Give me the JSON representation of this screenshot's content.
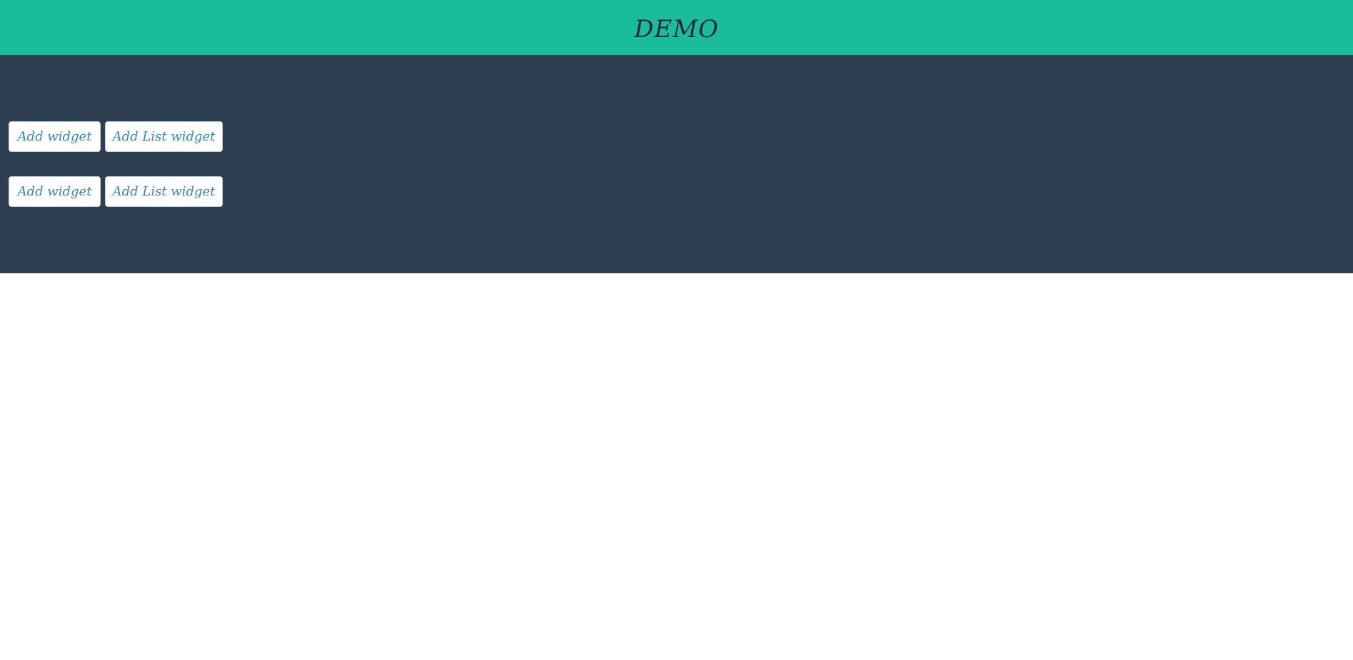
{
  "header": {
    "title": "DEMO"
  },
  "main": {
    "rows": [
      {
        "add_widget_label": "Add widget",
        "add_list_widget_label": "Add List widget"
      },
      {
        "add_widget_label": "Add widget",
        "add_list_widget_label": "Add List widget"
      }
    ]
  },
  "colors": {
    "header_bg": "#1abc9c",
    "main_bg": "#2c3e50",
    "button_text": "#3a86b8",
    "title_text": "#1f2b38"
  }
}
